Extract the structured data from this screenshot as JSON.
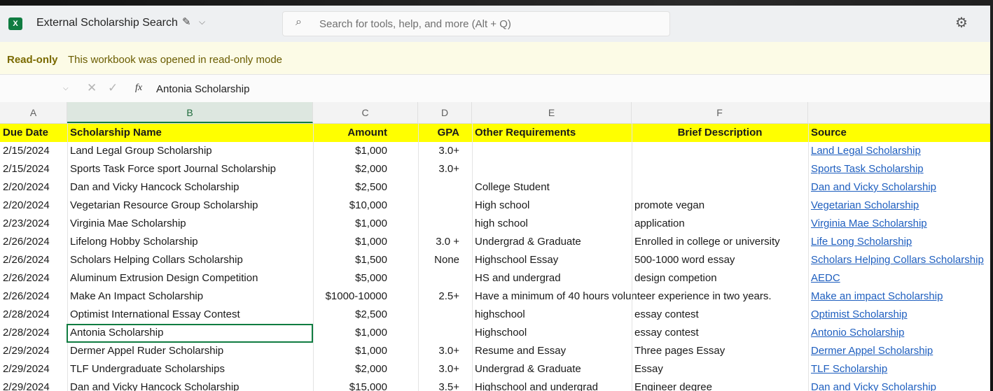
{
  "titlebar": {
    "app_icon": "excel-icon",
    "workbook_title": "External Scholarship Search",
    "search_placeholder": "Search for tools, help, and more (Alt + Q)"
  },
  "readonly_bar": {
    "label": "Read-only",
    "message": "This workbook was opened in read-only mode"
  },
  "formula_bar": {
    "fx_label": "fx",
    "content": "Antonia Scholarship"
  },
  "columns": [
    "A",
    "B",
    "C",
    "D",
    "E",
    "F",
    ""
  ],
  "selected_column": "B",
  "header_row": {
    "due_date": "Due Date",
    "name": "Scholarship Name",
    "amount": "Amount",
    "gpa": "GPA",
    "other": "Other Requirements",
    "desc": "Brief Description",
    "source": "Source"
  },
  "rows": [
    {
      "due_date": "2/15/2024",
      "name": "Land Legal Group Scholarship",
      "amount": "$1,000",
      "gpa": "3.0+",
      "other": "",
      "desc": "",
      "source": "Land Legal Scholarship"
    },
    {
      "due_date": "2/15/2024",
      "name": "Sports Task Force sport Journal Scholarship",
      "amount": "$2,000",
      "gpa": "3.0+",
      "other": "",
      "desc": "",
      "source": "Sports Task Scholarship"
    },
    {
      "due_date": "2/20/2024",
      "name": "Dan and Vicky Hancock Scholarship",
      "amount": "$2,500",
      "gpa": "",
      "other": "College Student",
      "desc": "",
      "source": "Dan and Vicky Scholarship"
    },
    {
      "due_date": "2/20/2024",
      "name": "Vegetarian Resource Group Scholarship",
      "amount": "$10,000",
      "gpa": "",
      "other": "High school",
      "desc": "promote vegan",
      "source": "Vegetarian Scholarship"
    },
    {
      "due_date": "2/23/2024",
      "name": " Virginia Mae Scholarship",
      "amount": "$1,000",
      "gpa": "",
      "other": "high school",
      "desc": "application",
      "source": "Virginia Mae Scholarship"
    },
    {
      "due_date": "2/26/2024",
      "name": "Lifelong Hobby Scholarship",
      "amount": "$1,000",
      "gpa": "3.0 +",
      "other": "Undergrad & Graduate",
      "desc": "Enrolled in college or university",
      "source": "Life Long Scholarship"
    },
    {
      "due_date": "2/26/2024",
      "name": "Scholars Helping Collars Scholarship",
      "amount": "$1,500",
      "gpa": "None",
      "other": "Highschool Essay",
      "desc": "500-1000 word essay",
      "source": "Scholars Helping Collars Scholarship"
    },
    {
      "due_date": "2/26/2024",
      "name": "Aluminum Extrusion Design Competition",
      "amount": "$5,000",
      "gpa": "",
      "other": "HS and undergrad",
      "desc": "design competion",
      "source": "AEDC"
    },
    {
      "due_date": "2/26/2024",
      "name": "Make An Impact Scholarship",
      "amount": "$1000-10000",
      "gpa": "2.5+",
      "other": "Have a minimum of 40 hours volunteer experience in two years.",
      "desc": "",
      "source": "Make an impact Scholarship"
    },
    {
      "due_date": "2/28/2024",
      "name": "Optimist International Essay Contest",
      "amount": "$2,500",
      "gpa": "",
      "other": "highschool",
      "desc": "essay contest",
      "source": "Optimist Scholarship"
    },
    {
      "due_date": "2/28/2024",
      "name": "Antonia Scholarship",
      "amount": "$1,000",
      "gpa": "",
      "other": "Highschool",
      "desc": "essay contest",
      "source": "Antonio Scholarship"
    },
    {
      "due_date": "2/29/2024",
      "name": "Dermer Appel Ruder Scholarship",
      "amount": "$1,000",
      "gpa": "3.0+",
      "other": "Resume and Essay",
      "desc": "Three pages Essay",
      "source": "Dermer Appel Scholarship"
    },
    {
      "due_date": "2/29/2024",
      "name": "TLF Undergraduate Scholarships",
      "amount": "$2,000",
      "gpa": "3.0+",
      "other": "Undergrad & Graduate",
      "desc": "Essay",
      "source": "TLF Scholarship"
    },
    {
      "due_date": "2/29/2024",
      "name": "Dan and Vicky Hancock Scholarship",
      "amount": "$15,000",
      "gpa": "3.5+",
      "other": "Highschool and undergrad",
      "desc": "Engineer degree",
      "source": "Dan and Vicky Scholarship"
    }
  ],
  "colors": {
    "header_fill": "#ffff00",
    "link": "#1f5fbf",
    "selection": "#107c41"
  }
}
